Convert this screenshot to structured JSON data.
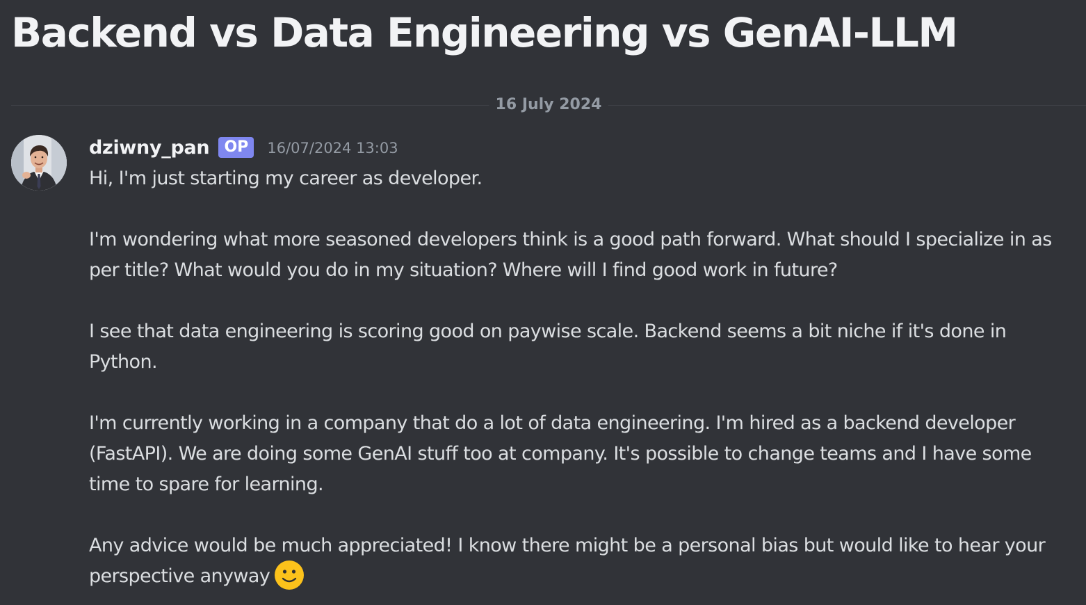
{
  "thread": {
    "title": "Backend vs Data Engineering vs GenAI-LLM"
  },
  "divider": {
    "date": "16 July 2024"
  },
  "message": {
    "author": "dziwny_pan",
    "badge": "OP",
    "timestamp": "16/07/2024 13:03",
    "paragraphs": [
      "Hi, I'm just starting my career as developer.",
      "I'm wondering what more seasoned developers think is a good path forward. What should I specialize in as per title? What would you do in my situation? Where will I find good work in future?",
      "I see that data engineering is scoring good on paywise scale. Backend seems a bit niche if it's done in Python.",
      "I'm currently working in a company that do a lot of data engineering. I'm hired as a backend developer (FastAPI). We are doing some GenAI stuff too at company. It's possible to change teams and I have some time to spare for learning.",
      "Any advice would be much appreciated! I know there might be a personal bias but would like to hear your perspective anyway"
    ],
    "trailing_emoji": "slightly-smiling-face-icon"
  },
  "colors": {
    "background": "#313338",
    "title_text": "#f2f3f5",
    "body_text": "#dbdee1",
    "muted_text": "#949ba4",
    "op_badge": "#7f87f0",
    "divider_line": "#3f4147",
    "emoji_yellow": "#fcc21b"
  }
}
